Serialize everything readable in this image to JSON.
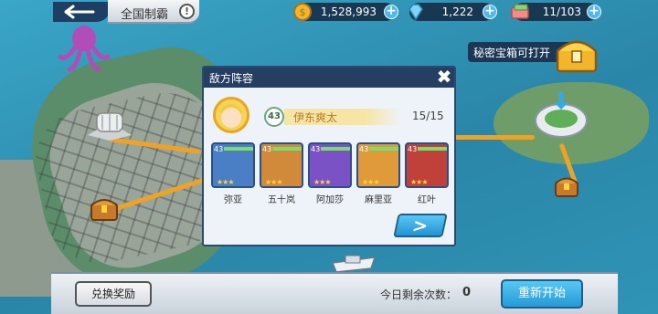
{
  "top_bar": {
    "title": "全国制霸",
    "info_icon": "!",
    "resources": [
      {
        "name": "coin",
        "icon": "coin-icon",
        "value": "1,528,993"
      },
      {
        "name": "diamond",
        "icon": "diamond-icon",
        "value": "1,222"
      },
      {
        "name": "ticket",
        "icon": "ticket-icon",
        "value": "11/103"
      }
    ],
    "plus_label": "+"
  },
  "secret_chest": {
    "label": "秘密宝箱可打开"
  },
  "dialog": {
    "title": "敌方阵容",
    "close_label": "✖",
    "opponent": {
      "level": "43",
      "name": "伊东爽太",
      "count": "15/15"
    },
    "cards": [
      {
        "name": "弥亚",
        "level": "43",
        "stars": "★★★",
        "color": "#4a7fc6"
      },
      {
        "name": "五十岚",
        "level": "43",
        "stars": "★★★",
        "color": "#d08a3a"
      },
      {
        "name": "阿加莎",
        "level": "43",
        "stars": "★★★",
        "color": "#7a52c6"
      },
      {
        "name": "麻里亚",
        "level": "43",
        "stars": "★★★",
        "color": "#e09a3a"
      },
      {
        "name": "红叶",
        "level": "43",
        "stars": "★★★",
        "color": "#c0403a"
      }
    ],
    "next_label": ">"
  },
  "bottom_bar": {
    "redeem_label": "兑换奖励",
    "remaining_label": "今日剩余次数：",
    "remaining_count": "0",
    "restart_label": "重新开始"
  },
  "colors": {
    "header": "#253f63",
    "accent_blue": "#2799d6",
    "path": "#f0a323"
  }
}
